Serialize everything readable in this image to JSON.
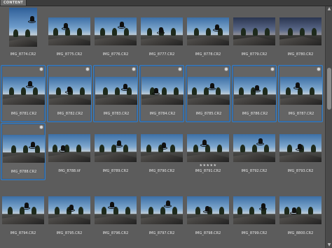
{
  "panel": {
    "tab_label": "CONTENT"
  },
  "rows": [
    [
      {
        "label": "IMG_8774.CR2",
        "selected": false,
        "portrait": true
      },
      {
        "label": "IMG_8775.CR2",
        "selected": false
      },
      {
        "label": "IMG_8776.CR2",
        "selected": false
      },
      {
        "label": "IMG_8777.CR2",
        "selected": false
      },
      {
        "label": "IMG_8778.CR2",
        "selected": false
      },
      {
        "label": "IMG_8779.CR2",
        "selected": false,
        "dusk": true
      },
      {
        "label": "IMG_8780.CR2",
        "selected": false,
        "dusk": true
      }
    ],
    [
      {
        "label": "IMG_8781.CR2",
        "selected": true,
        "badge": true
      },
      {
        "label": "IMG_8782.CR2",
        "selected": true,
        "badge": true
      },
      {
        "label": "IMG_8783.CR2",
        "selected": true,
        "badge": true
      },
      {
        "label": "IMG_8784.CR2",
        "selected": true,
        "badge": true
      },
      {
        "label": "IMG_8785.CR2",
        "selected": true,
        "badge": true
      },
      {
        "label": "IMG_8786.CR2",
        "selected": true,
        "badge": true
      },
      {
        "label": "IMG_8787.CR2",
        "selected": true,
        "badge": true
      }
    ],
    [
      {
        "label": "IMG_8788.CR2",
        "selected": true,
        "badge": true
      },
      {
        "label": "IMG_8788.tif",
        "selected": false
      },
      {
        "label": "IMG_8789.CR2",
        "selected": false
      },
      {
        "label": "IMG_8790.CR2",
        "selected": false
      },
      {
        "label": "IMG_8791.CR2",
        "selected": false,
        "stars": "★★★★★"
      },
      {
        "label": "IMG_8792.CR2",
        "selected": false
      },
      {
        "label": "IMG_8793.CR2",
        "selected": false
      }
    ],
    [
      {
        "label": "IMG_8794.CR2",
        "selected": false
      },
      {
        "label": "IMG_8795.CR2",
        "selected": false
      },
      {
        "label": "IMG_8796.CR2",
        "selected": false
      },
      {
        "label": "IMG_8797.CR2",
        "selected": false
      },
      {
        "label": "IMG_8798.CR2",
        "selected": false
      },
      {
        "label": "IMG_8799.CR2",
        "selected": false
      },
      {
        "label": "IMG_8800.CR2",
        "selected": false
      }
    ]
  ],
  "colors": {
    "selection": "#3d7fbf",
    "background": "#5c5c5c"
  }
}
